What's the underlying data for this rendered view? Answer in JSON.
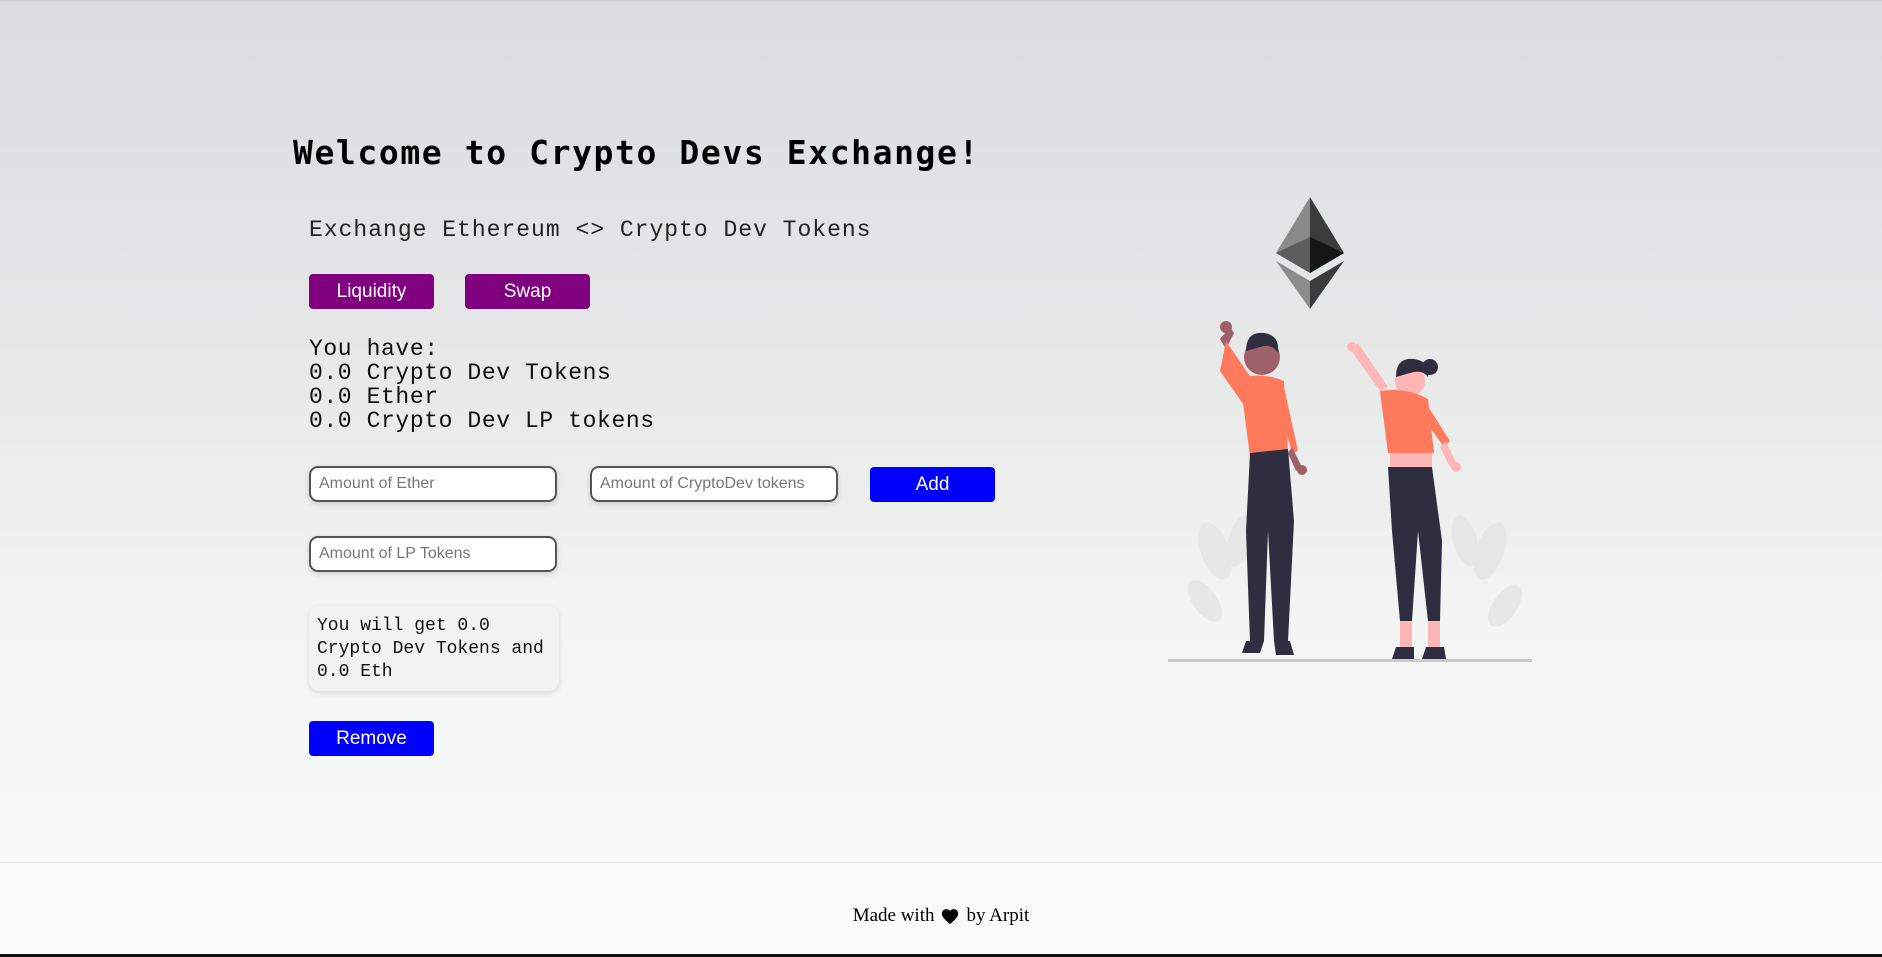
{
  "page": {
    "title": "Welcome to Crypto Devs Exchange!",
    "subtitle": "Exchange Ethereum <> Crypto Dev Tokens"
  },
  "tabs": {
    "liquidity_label": "Liquidity",
    "swap_label": "Swap"
  },
  "balances": {
    "heading": "You have:",
    "crypto_dev_tokens": "0.0 Crypto Dev Tokens",
    "ether": "0.0 Ether",
    "lp_tokens": "0.0 Crypto Dev LP tokens"
  },
  "add_liquidity": {
    "ether_placeholder": "Amount of Ether",
    "cd_placeholder": "Amount of CryptoDev tokens",
    "ether_value": "",
    "cd_value": "",
    "add_label": "Add"
  },
  "remove_liquidity": {
    "lp_placeholder": "Amount of LP Tokens",
    "lp_value": "",
    "result_text": "You will get 0.0 Crypto Dev Tokens and 0.0 Eth",
    "remove_label": "Remove"
  },
  "footer": {
    "made_with": "Made with",
    "by": "by Arpit",
    "heart_icon": "heart-icon"
  },
  "colors": {
    "purple": "#800080",
    "blue": "#0000ff",
    "coral": "#ff7a5c",
    "dark": "#2f2e41"
  }
}
